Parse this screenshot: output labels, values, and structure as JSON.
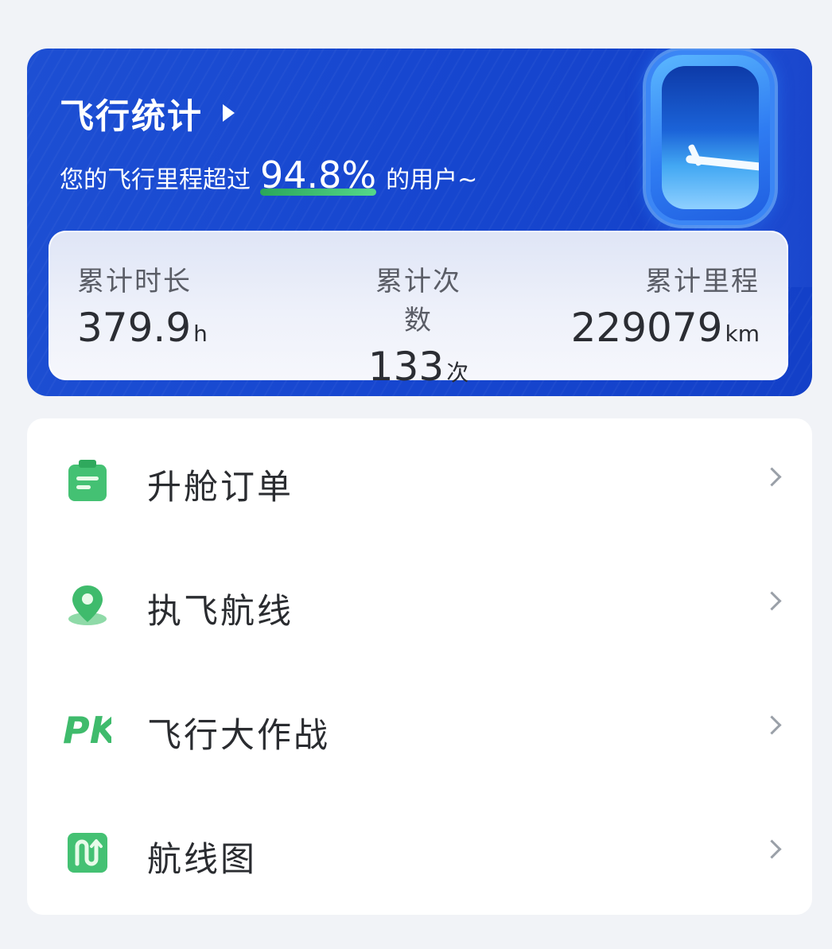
{
  "stats_card": {
    "title": "飞行统计",
    "subtitle_prefix": "您的飞行里程超过",
    "percentile": "94.8%",
    "subtitle_suffix": "的用户~",
    "metrics": [
      {
        "label": "累计时长",
        "value": "379.9",
        "unit": "h"
      },
      {
        "label": "累计次数",
        "value": "133",
        "unit": "次"
      },
      {
        "label": "累计里程",
        "value": "229079",
        "unit": "km"
      }
    ]
  },
  "menu": {
    "items": [
      {
        "label": "升舱订单",
        "icon": "clipboard-icon"
      },
      {
        "label": "执飞航线",
        "icon": "location-pin-icon"
      },
      {
        "label": "飞行大作战",
        "icon": "pk-icon"
      },
      {
        "label": "航线图",
        "icon": "route-map-icon"
      }
    ]
  },
  "colors": {
    "card_blue": "#1747d0",
    "accent_green": "#3fbf6c",
    "background": "#f1f3f7"
  }
}
